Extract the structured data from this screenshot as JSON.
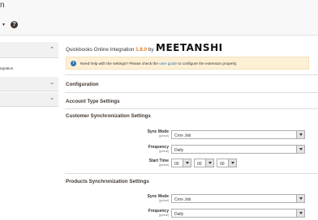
{
  "header": {
    "title": "n",
    "scope_arrow": "▾",
    "help_icon": "?"
  },
  "sidebar": {
    "active_item_label": "egration"
  },
  "extension": {
    "title_prefix": "Quickbooks Online Integration",
    "version": "1.8.0",
    "by": "by",
    "brand": "MEETANSHI"
  },
  "notice": {
    "before": "Need help with the settings? Please check the",
    "link": "user guide",
    "after": "to configure the extension properly."
  },
  "sections": {
    "configuration": "Configuration",
    "account_type": "Account Type Settings",
    "customer_sync": "Customer Synchronization Settings",
    "products_sync": "Products Synchronization Settings"
  },
  "customer_sync": {
    "sync_mode": {
      "label": "Sync Mode",
      "scope": "[global]",
      "value": "Cron Job"
    },
    "frequency": {
      "label": "Frequency",
      "scope": "[global]",
      "value": "Daily"
    },
    "start_time": {
      "label": "Start Time",
      "scope": "[global]",
      "hour": "00",
      "minute": "00",
      "second": "00"
    }
  },
  "products_sync": {
    "sync_mode": {
      "label": "Sync Mode",
      "scope": "[global]",
      "value": "Cron Job"
    },
    "frequency": {
      "label": "Frequency",
      "scope": "[global]",
      "value": "Daily"
    }
  },
  "colors": {
    "accent": "#e87a1e",
    "notice_bg": "#fdf0d5",
    "link": "#1979c3"
  }
}
